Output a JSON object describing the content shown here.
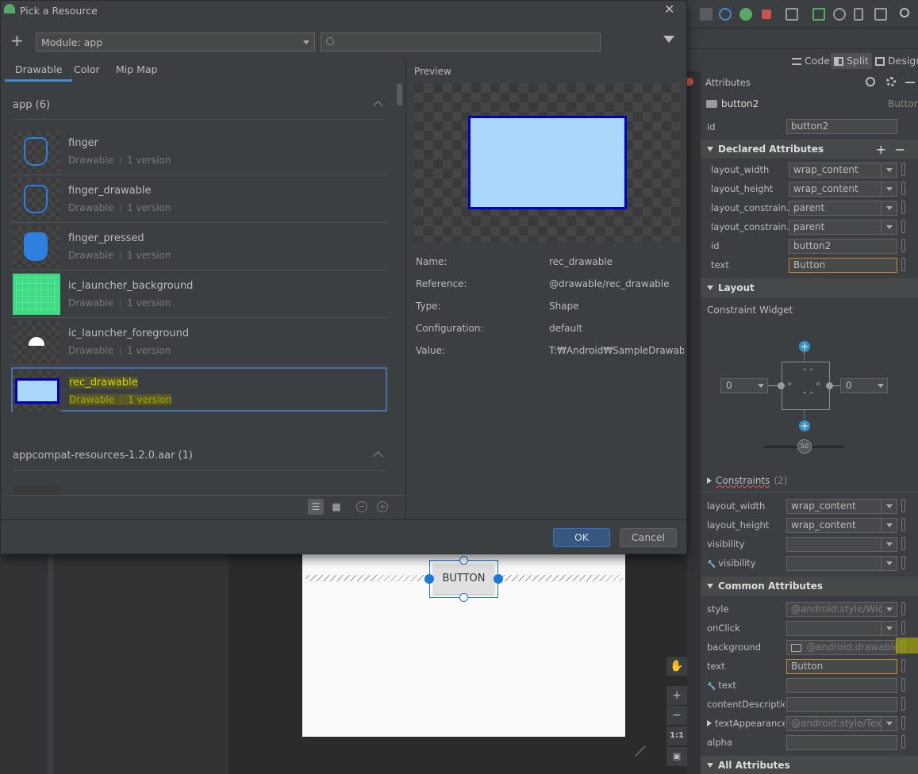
{
  "dialog": {
    "title": "Pick a Resource",
    "module_label": "Module: app",
    "search_placeholder": "",
    "tabs": [
      "Drawable",
      "Color",
      "Mip Map"
    ],
    "active_tab": "Drawable",
    "groups": [
      {
        "name": "app",
        "count": "(6)",
        "items": [
          {
            "name": "finger",
            "type": "Drawable",
            "versions": "1 version",
            "icon": "hand-pointer-outline-icon"
          },
          {
            "name": "finger_drawable",
            "type": "Drawable",
            "versions": "1 version",
            "icon": "hand-pointer-outline-icon"
          },
          {
            "name": "finger_pressed",
            "type": "Drawable",
            "versions": "1 version",
            "icon": "hand-pointer-filled-icon"
          },
          {
            "name": "ic_launcher_background",
            "type": "Drawable",
            "versions": "1 version",
            "icon": "green-grid-icon"
          },
          {
            "name": "ic_launcher_foreground",
            "type": "Drawable",
            "versions": "1 version",
            "icon": "android-robot-icon"
          },
          {
            "name": "rec_drawable",
            "type": "Drawable",
            "versions": "1 version",
            "icon": "blue-rectangle-icon",
            "selected": true
          }
        ]
      },
      {
        "name": "appcompat-resources-1.2.0.aar",
        "count": "(1)"
      }
    ],
    "preview": {
      "header": "Preview",
      "fields": [
        {
          "key": "Name:",
          "value": "rec_drawable"
        },
        {
          "key": "Reference:",
          "value": "@drawable/rec_drawable"
        },
        {
          "key": "Type:",
          "value": "Shape"
        },
        {
          "key": "Configuration:",
          "value": "default"
        },
        {
          "key": "Value:",
          "value": "T:₩Android₩SampleDrawab..."
        }
      ]
    },
    "ok_label": "OK",
    "cancel_label": "Cancel"
  },
  "ide": {
    "view_tabs": [
      "Code",
      "Split",
      "Design"
    ],
    "active_view": "Split",
    "attributes_title": "Attributes",
    "component_name": "button2",
    "component_type": "Button",
    "id_label": "id",
    "id_value": "button2",
    "declared_header": "Declared Attributes",
    "declared": [
      {
        "label": "layout_width",
        "value": "wrap_content",
        "dropdown": true
      },
      {
        "label": "layout_height",
        "value": "wrap_content",
        "dropdown": true
      },
      {
        "label": "layout_constrain...",
        "value": "parent",
        "dropdown": true
      },
      {
        "label": "layout_constrain...",
        "value": "parent",
        "dropdown": true
      },
      {
        "label": "id",
        "value": "button2",
        "dropdown": false
      },
      {
        "label": "text",
        "value": "Button",
        "dropdown": false,
        "highlight": true
      }
    ],
    "layout_header": "Layout",
    "constraint_widget_label": "Constraint Widget",
    "margin_left": "0",
    "margin_right": "0",
    "bias": "50",
    "constraints_label": "Constraints",
    "constraints_count": "(2)",
    "layout_attrs": [
      {
        "label": "layout_width",
        "value": "wrap_content"
      },
      {
        "label": "layout_height",
        "value": "wrap_content"
      },
      {
        "label": "visibility",
        "value": ""
      },
      {
        "label": "visibility",
        "value": "",
        "tool": true
      }
    ],
    "common_header": "Common Attributes",
    "common": [
      {
        "label": "style",
        "value": "@android:style/Wic",
        "dropdown": true,
        "dim": true
      },
      {
        "label": "onClick",
        "value": "",
        "dropdown": true
      },
      {
        "label": "background",
        "value": "@android:drawable/b",
        "dim": true,
        "image": true
      },
      {
        "label": "text",
        "value": "Button",
        "highlight": true
      },
      {
        "label": "text",
        "value": "",
        "tool": true
      },
      {
        "label": "contentDescription",
        "value": ""
      },
      {
        "label": "textAppearance",
        "value": "@android:style/Tex",
        "dropdown": true,
        "dim": true,
        "expand": true
      },
      {
        "label": "alpha",
        "value": ""
      }
    ],
    "all_header": "All Attributes",
    "canvas_button": "BUTTON",
    "zoom_fit": "1:1"
  },
  "colors": {
    "accent": "#4a88c7",
    "selection_border": "#4a6ea9",
    "highlight_field": "#c48b2c",
    "ok_button": "#365880",
    "preview_fill": "#aad8fb",
    "preview_stroke": "#0000c8"
  }
}
